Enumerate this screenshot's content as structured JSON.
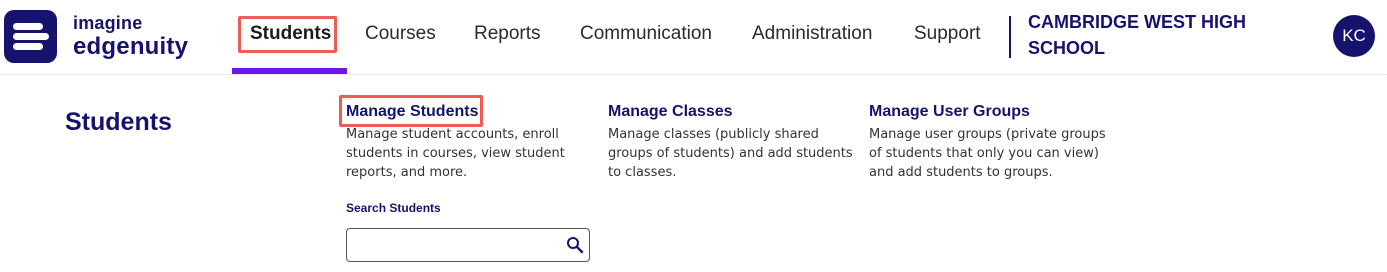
{
  "brand": {
    "line1": "imagine",
    "line2": "edgenuity",
    "color": "#15136e"
  },
  "nav": {
    "items": [
      {
        "label": "Students",
        "active": true
      },
      {
        "label": "Courses"
      },
      {
        "label": "Reports"
      },
      {
        "label": "Communication"
      },
      {
        "label": "Administration"
      },
      {
        "label": "Support"
      }
    ],
    "accent_color": "#6d16e8",
    "highlight_color": "#ee5c55"
  },
  "school": {
    "name": "CAMBRIDGE WEST HIGH SCHOOL"
  },
  "user": {
    "initials": "KC"
  },
  "page": {
    "title": "Students"
  },
  "sections": [
    {
      "link": "Manage Students",
      "description": "Manage student accounts, enroll students in courses, view student reports, and more."
    },
    {
      "link": "Manage Classes",
      "description": "Manage classes (publicly shared groups of students) and add students to classes."
    },
    {
      "link": "Manage User Groups",
      "description": "Manage user groups (private groups of students that only you can view) and add students to groups."
    }
  ],
  "search": {
    "label": "Search Students",
    "value": "",
    "placeholder": "",
    "icon": "search-icon"
  }
}
